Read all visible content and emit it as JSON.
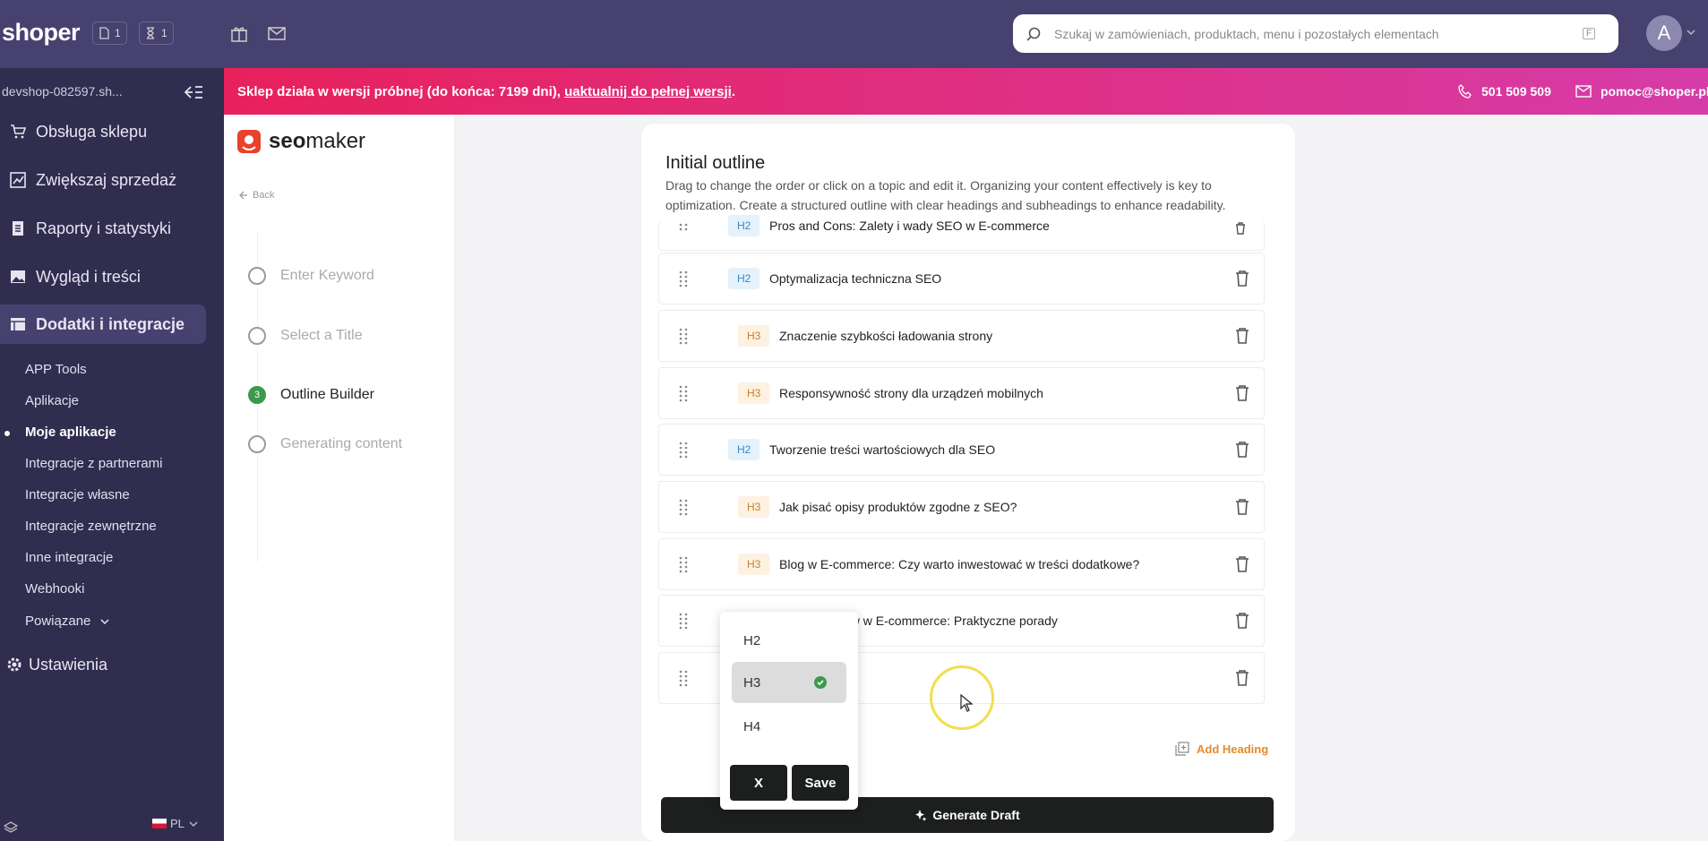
{
  "topbar": {
    "logo": "shoper",
    "badge1_count": "1",
    "badge2_count": "1",
    "search_placeholder": "Szukaj w zamówieniach, produktach, menu i pozostałych elementach",
    "search_shortcut": "F",
    "avatar_letter": "A"
  },
  "sidebar": {
    "shop_name": "devshop-082597.sh...",
    "nav": [
      {
        "label": "Obsługa sklepu",
        "icon": "cart-icon"
      },
      {
        "label": "Zwiększaj sprzedaż",
        "icon": "chart-icon"
      },
      {
        "label": "Raporty i statystyki",
        "icon": "report-icon"
      },
      {
        "label": "Wygląd i treści",
        "icon": "image-icon"
      },
      {
        "label": "Dodatki i integracje",
        "icon": "puzzle-icon"
      }
    ],
    "sub": [
      {
        "label": "APP Tools"
      },
      {
        "label": "Aplikacje"
      },
      {
        "label": "Moje aplikacje"
      },
      {
        "label": "Integracje z partnerami"
      },
      {
        "label": "Integracje własne"
      },
      {
        "label": "Integracje zewnętrzne"
      },
      {
        "label": "Inne integracje"
      },
      {
        "label": "Webhooki"
      },
      {
        "label": "Powiązane"
      }
    ],
    "settings": "Ustawienia",
    "lang": "PL"
  },
  "banner": {
    "message": "Sklep działa w wersji próbnej (do końca: 7199 dni),",
    "link": "uaktualnij do pełnej wersji",
    "period": ".",
    "phone": "501 509 509",
    "email": "pomoc@shoper.pl"
  },
  "leftpanel": {
    "brand_seo": "seo",
    "brand_maker": "maker",
    "back": "Back",
    "steps": [
      {
        "label": "Enter Keyword"
      },
      {
        "label": "Select a Title"
      },
      {
        "label": "Outline Builder",
        "number": "3"
      },
      {
        "label": "Generating content"
      }
    ]
  },
  "outline": {
    "title": "Initial outline",
    "description": "Drag to change the order or click on a topic and edit it. Organizing your content effectively is key to optimization. Create a structured outline with clear headings and subheadings to enhance readability.",
    "rows": [
      {
        "level": "H2",
        "text": "Pros and Cons: Zalety i wady SEO w E-commerce"
      },
      {
        "level": "H2",
        "text": "Optymalizacja techniczna SEO"
      },
      {
        "level": "H3",
        "text": "Znaczenie szybkości ładowania strony"
      },
      {
        "level": "H3",
        "text": "Responsywność strony dla urządzeń mobilnych"
      },
      {
        "level": "H2",
        "text": "Tworzenie treści wartościowych dla SEO"
      },
      {
        "level": "H3",
        "text": "Jak pisać opisy produktów zgodne z SEO?"
      },
      {
        "level": "H3",
        "text": "Blog w E-commerce: Czy warto inwestować w treści dodatkowe?"
      },
      {
        "level": "",
        "text": "ków w E-commerce: Praktyczne porady"
      },
      {
        "level": "",
        "text": ""
      }
    ],
    "add_heading": "Add Heading",
    "generate_draft": "Generate Draft"
  },
  "dropdown": {
    "options": [
      {
        "label": "H2"
      },
      {
        "label": "H3",
        "selected": true
      },
      {
        "label": "H4"
      }
    ],
    "cancel": "X",
    "save": "Save"
  },
  "colors": {
    "topbar": "#47416f",
    "sidebar": "#302d4f",
    "banner_start": "#e8215c",
    "banner_end": "#d63ca8",
    "h2_tag": "#e5f2fb",
    "h3_tag": "#fdf1e1",
    "accent_orange": "#e48b2c",
    "step_done": "#3b9a4c"
  }
}
